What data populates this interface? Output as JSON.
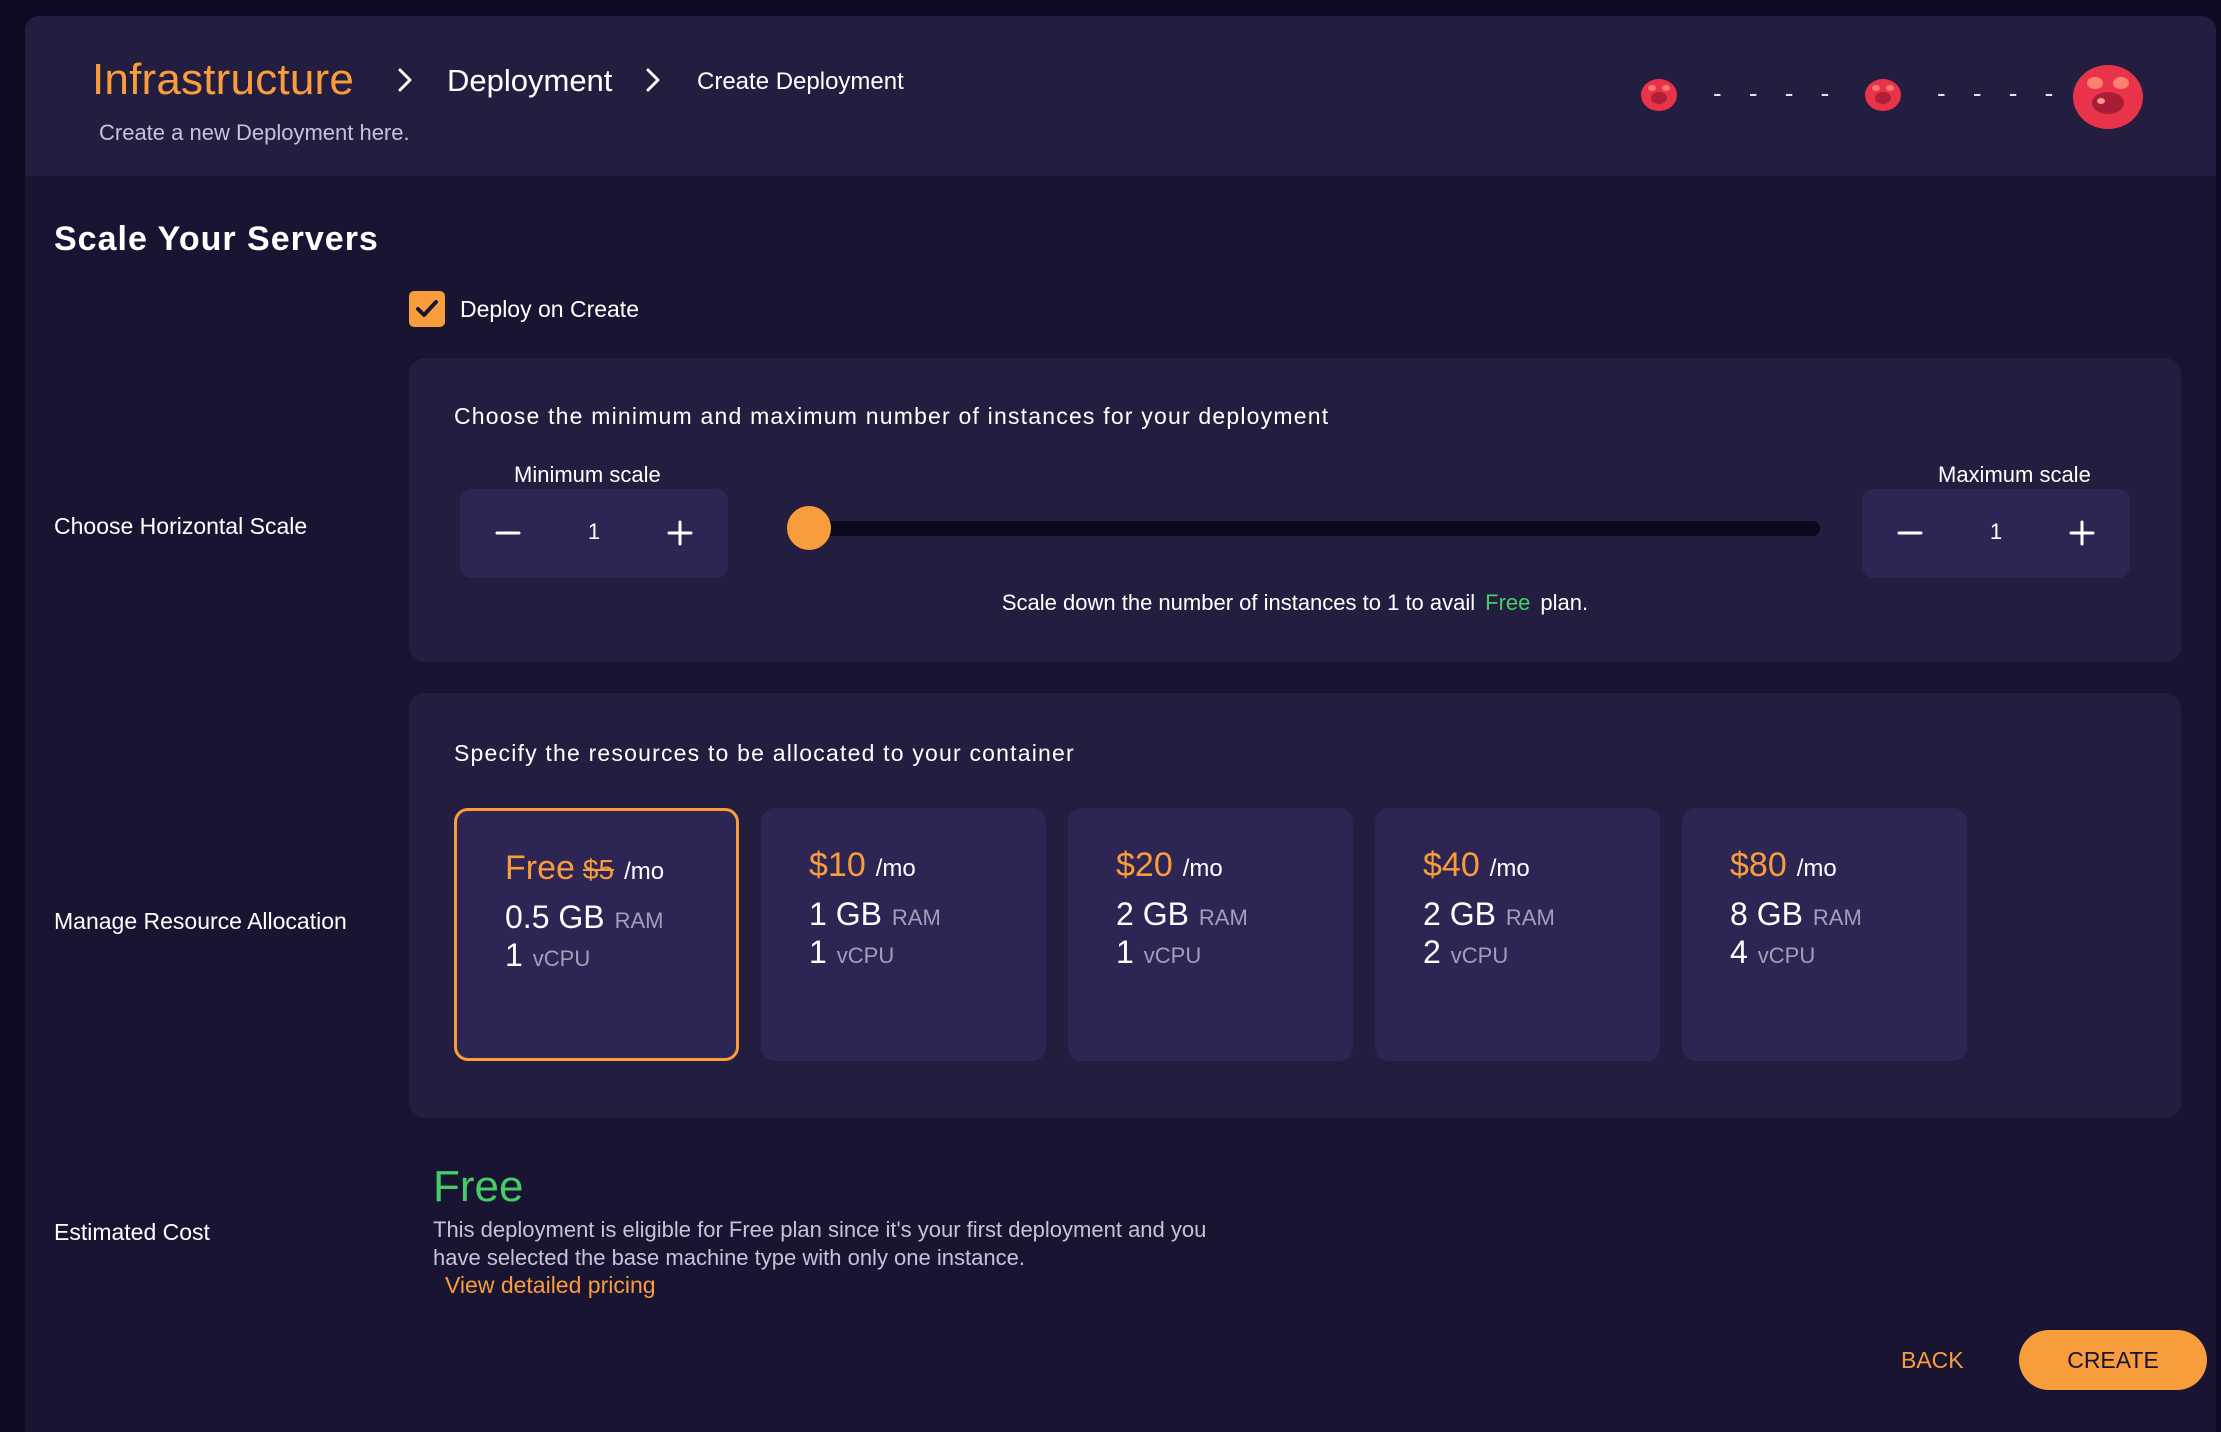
{
  "breadcrumb": {
    "root": "Infrastructure",
    "middle": "Deployment",
    "current": "Create Deployment"
  },
  "header": {
    "subtitle": "Create a new Deployment here.",
    "status_1": "- - - -",
    "status_2": "- - - -"
  },
  "page": {
    "section_title": "Scale Your Servers",
    "deploy_on_create_label": "Deploy on Create",
    "deploy_on_create_checked": true
  },
  "labels": {
    "horizontal_scale": "Choose Horizontal Scale",
    "resource_allocation": "Manage Resource Allocation",
    "estimated_cost": "Estimated Cost"
  },
  "scale": {
    "title": "Choose the minimum and maximum number of instances for your deployment",
    "min_label": "Minimum scale",
    "min_value": "1",
    "max_label": "Maximum scale",
    "max_value": "1",
    "slider_value": 1,
    "note_prefix": "Scale down the number of instances to 1 to avail",
    "note_free": "Free",
    "note_suffix": "plan."
  },
  "resources": {
    "title": "Specify the resources to be allocated to your container",
    "plans": [
      {
        "price": "Free",
        "original_price": "$5",
        "per": "/mo",
        "ram": "0.5 GB",
        "ram_unit": "RAM",
        "cpu": "1",
        "cpu_unit": "vCPU",
        "selected": true
      },
      {
        "price": "$10",
        "original_price": "",
        "per": "/mo",
        "ram": "1 GB",
        "ram_unit": "RAM",
        "cpu": "1",
        "cpu_unit": "vCPU",
        "selected": false
      },
      {
        "price": "$20",
        "original_price": "",
        "per": "/mo",
        "ram": "2 GB",
        "ram_unit": "RAM",
        "cpu": "1",
        "cpu_unit": "vCPU",
        "selected": false
      },
      {
        "price": "$40",
        "original_price": "",
        "per": "/mo",
        "ram": "2 GB",
        "ram_unit": "RAM",
        "cpu": "2",
        "cpu_unit": "vCPU",
        "selected": false
      },
      {
        "price": "$80",
        "original_price": "",
        "per": "/mo",
        "ram": "8 GB",
        "ram_unit": "RAM",
        "cpu": "4",
        "cpu_unit": "vCPU",
        "selected": false
      }
    ]
  },
  "cost": {
    "amount": "Free",
    "description": "This deployment is eligible for Free plan since it's your first deployment and you have selected the base machine type with only one instance.",
    "link": "View detailed pricing"
  },
  "actions": {
    "back": "BACK",
    "create": "CREATE"
  },
  "colors": {
    "accent": "#f99d3c",
    "free_green": "#44cc66",
    "background": "#1a1433",
    "panel": "#231e40"
  },
  "icons": {
    "breadcrumb_separator": "chevron-right-icon",
    "avatar": "blob-avatar-icon",
    "checkbox": "checkmark-icon",
    "decrement": "minus-icon",
    "increment": "plus-icon"
  }
}
